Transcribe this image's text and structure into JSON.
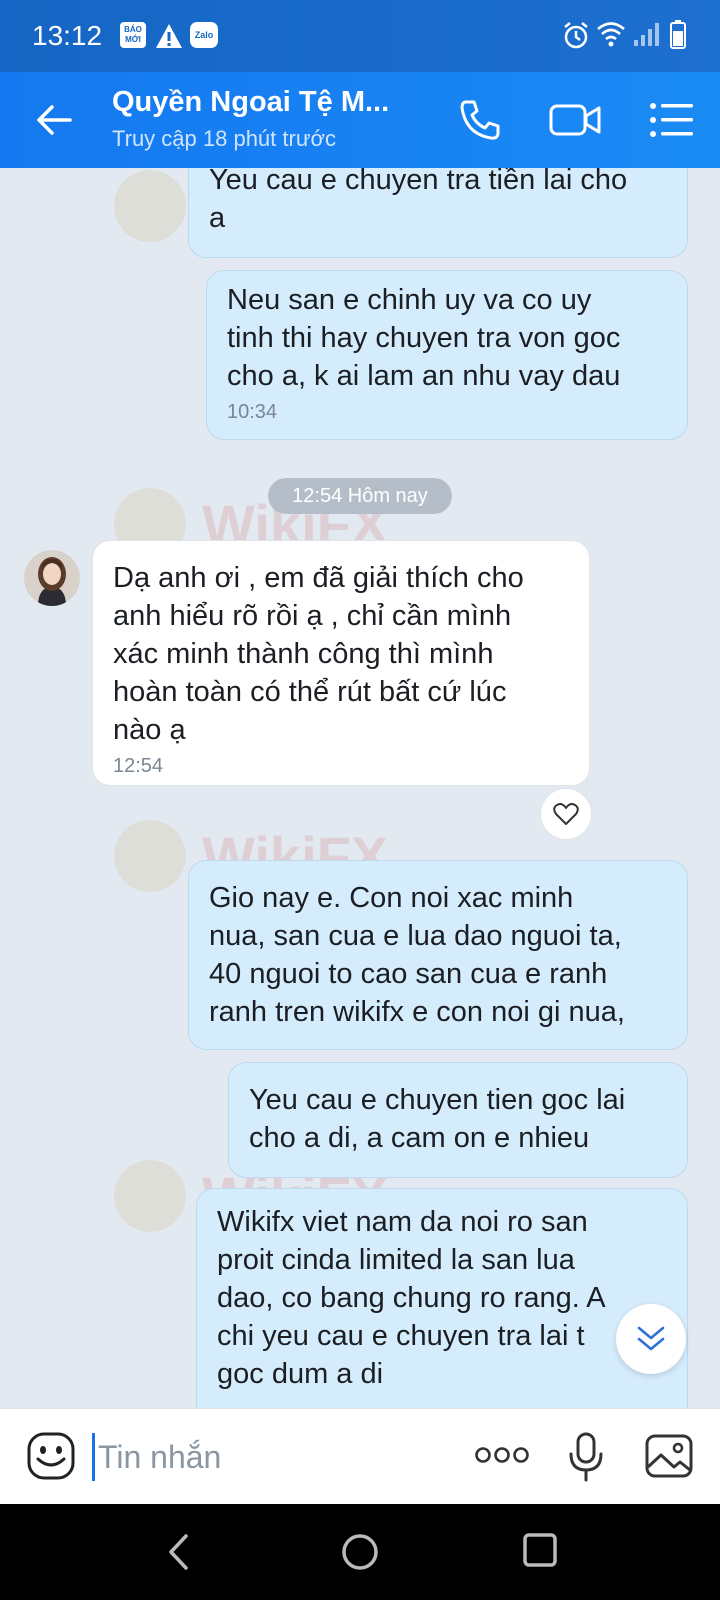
{
  "status_bar": {
    "time": "13:12",
    "notif_labels": [
      "BÁO MỚI",
      "Zalo"
    ]
  },
  "header": {
    "title": "Quyền Ngoai Tệ M...",
    "subtitle": "Truy cập 18 phút trước"
  },
  "messages": [
    {
      "text": "Yeu cau e chuyen tra tiền lai cho\na",
      "time": ""
    },
    {
      "text": " Neu san e chinh uy va co uy\ntinh thi hay chuyen tra von goc\ncho a, k ai lam an nhu vay dau",
      "time": "10:34"
    },
    {
      "text": "Dạ anh ơi  , em đã giải thích cho\nanh hiểu rõ rồi ạ , chỉ cần mình\nxác minh thành công thì mình\nhoàn toàn có thể rút bất cứ lúc\nnào ạ",
      "time": "12:54"
    },
    {
      "text": "Gio nay e. Con noi xac minh\nnua, san cua e lua dao nguoi ta,\n40 nguoi to cao san cua e ranh\nranh tren wikifx e con noi gi nua,",
      "time": ""
    },
    {
      "text": "Yeu cau e chuyen tien goc lai\ncho a di, a cam on e nhieu",
      "time": ""
    },
    {
      "text": "Wikifx viet nam da noi ro san\nproit cinda limited la san lua\ndao, co bang chung ro rang. A\nchi yeu cau e chuyen tra lai t\ngoc dum a di",
      "time": ""
    }
  ],
  "date_separator": "12:54 Hôm nay",
  "composer": {
    "placeholder": "Tin nhắn"
  },
  "watermark": "WikiFX",
  "colors": {
    "header": "#1a80f2",
    "sent_bubble": "#d5ecfd",
    "chat_bg": "#e2e9f1"
  }
}
